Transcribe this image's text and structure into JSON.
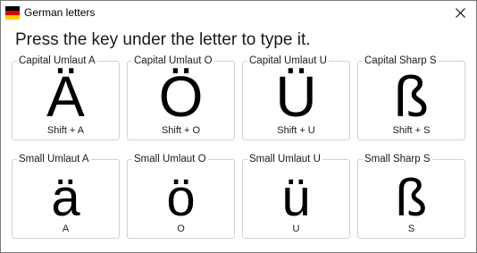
{
  "window": {
    "title": "German letters",
    "flag_colors": [
      "#000000",
      "#dd0000",
      "#ffce00"
    ]
  },
  "instruction": "Press the key under the letter to type it.",
  "keys": [
    {
      "label": "Capital Umlaut A",
      "letter": "Ä",
      "shortcut": "Shift + A"
    },
    {
      "label": "Capital Umlaut O",
      "letter": "Ö",
      "shortcut": "Shift + O"
    },
    {
      "label": "Capital Umlaut U",
      "letter": "Ü",
      "shortcut": "Shift + U"
    },
    {
      "label": "Capital Sharp S",
      "letter": "ß",
      "shortcut": "Shift + S"
    },
    {
      "label": "Small Umlaut A",
      "letter": "ä",
      "shortcut": "A"
    },
    {
      "label": "Small Umlaut O",
      "letter": "ö",
      "shortcut": "O"
    },
    {
      "label": "Small Umlaut U",
      "letter": "ü",
      "shortcut": "U"
    },
    {
      "label": "Small Sharp S",
      "letter": "ß",
      "shortcut": "S"
    }
  ]
}
